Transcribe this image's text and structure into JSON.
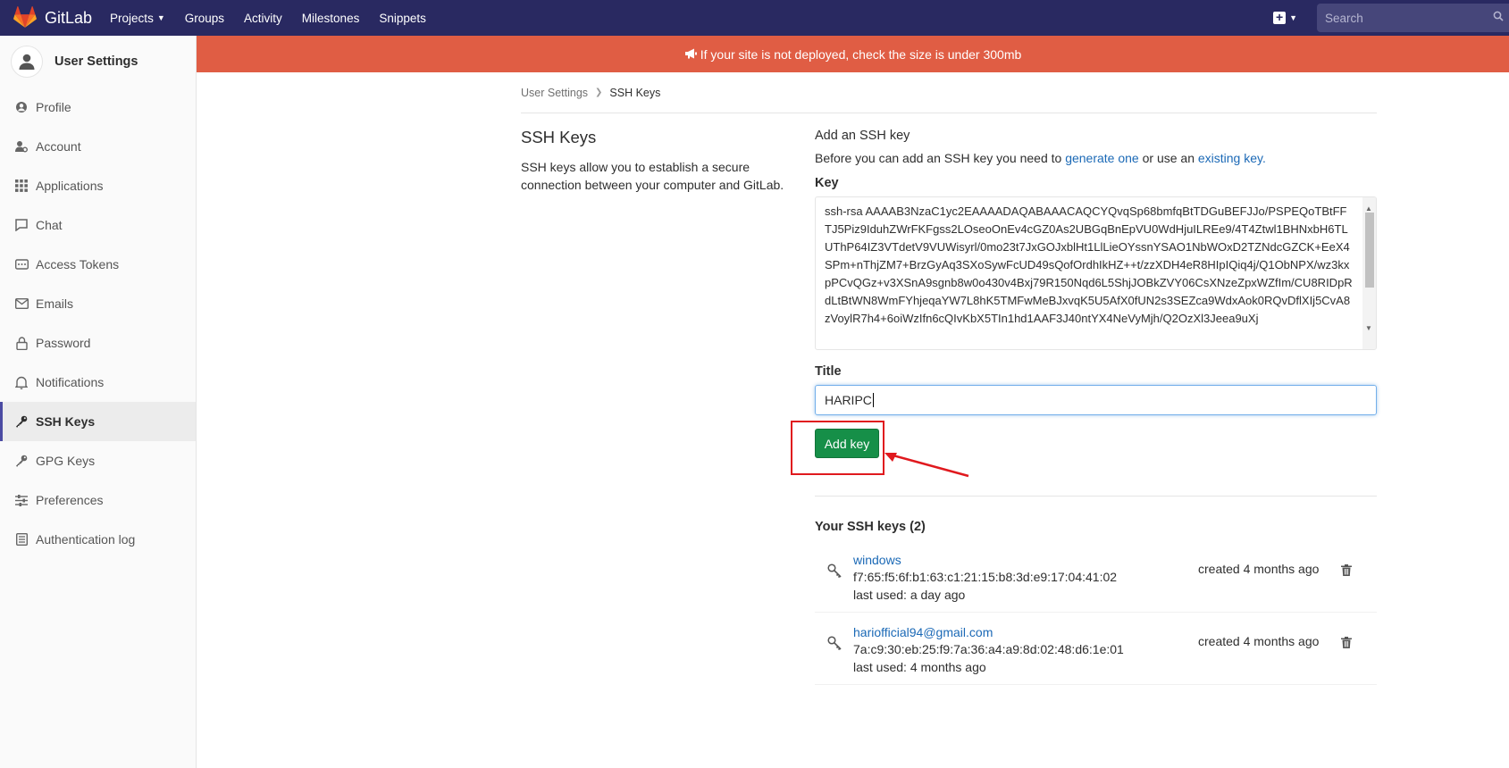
{
  "nav": {
    "brand": "GitLab",
    "links": [
      "Projects",
      "Groups",
      "Activity",
      "Milestones",
      "Snippets"
    ],
    "search_placeholder": "Search"
  },
  "sidebar": {
    "title": "User Settings",
    "items": [
      {
        "label": "Profile",
        "icon": "profile-icon"
      },
      {
        "label": "Account",
        "icon": "account-icon"
      },
      {
        "label": "Applications",
        "icon": "applications-icon"
      },
      {
        "label": "Chat",
        "icon": "chat-icon"
      },
      {
        "label": "Access Tokens",
        "icon": "access-tokens-icon"
      },
      {
        "label": "Emails",
        "icon": "emails-icon"
      },
      {
        "label": "Password",
        "icon": "password-icon"
      },
      {
        "label": "Notifications",
        "icon": "notifications-icon"
      },
      {
        "label": "SSH Keys",
        "icon": "ssh-keys-icon",
        "active": true
      },
      {
        "label": "GPG Keys",
        "icon": "gpg-keys-icon"
      },
      {
        "label": "Preferences",
        "icon": "preferences-icon"
      },
      {
        "label": "Authentication log",
        "icon": "authentication-log-icon"
      }
    ]
  },
  "banner": {
    "text": "If your site is not deployed, check the size is under 300mb"
  },
  "breadcrumb": {
    "parent": "User Settings",
    "current": "SSH Keys"
  },
  "intro": {
    "title": "SSH Keys",
    "description": "SSH keys allow you to establish a secure connection between your computer and GitLab."
  },
  "form": {
    "heading": "Add an SSH key",
    "help_prefix": "Before you can add an SSH key you need to",
    "help_link1": "generate one",
    "help_middle": "or use an",
    "help_link2": "existing key.",
    "key_label": "Key",
    "key_value": "ssh-rsa AAAAB3NzaC1yc2EAAAADAQABAAACAQCYQvqSp68bmfqBtTDGuBEFJJo/PSPEQoTBtFFTJ5Piz9IduhZWrFKFgss2LOseoOnEv4cGZ0As2UBGqBnEpVU0WdHjuILREe9/4T4Ztwl1BHNxbH6TLUThP64IZ3VTdetV9VUWisyrl/0mo23t7JxGOJxblHt1LlLieOYssnYSAO1NbWOxD2TZNdcGZCK+EeX4SPm+nThjZM7+BrzGyAq3SXoSywFcUD49sQofOrdhIkHZ++t/zzXDH4eR8HIpIQiq4j/Q1ObNPX/wz3kxpPCvQGz+v3XSnA9sgnb8w0o430v4Bxj79R150Nqd6L5ShjJOBkZVY06CsXNzeZpxWZfIm/CU8RIDpRdLtBtWN8WmFYhjeqaYW7L8hK5TMFwMeBJxvqK5U5AfX0fUN2s3SEZca9WdxAok0RQvDflXIj5CvA8zVoylR7h4+6oiWzIfn6cQIvKbX5TIn1hd1AAF3J40ntYX4NeVyMjh/Q2OzXl3Jeea9uXj",
    "title_label": "Title",
    "title_value": "HARIPC",
    "add_button": "Add key"
  },
  "keys": {
    "heading": "Your SSH keys (2)",
    "items": [
      {
        "name": "windows",
        "fingerprint": "f7:65:f5:6f:b1:63:c1:21:15:b8:3d:e9:17:04:41:02",
        "last_used": "last used: a day ago",
        "created": "created 4 months ago"
      },
      {
        "name": "hariofficial94@gmail.com",
        "fingerprint": "7a:c9:30:eb:25:f9:7a:36:a4:a9:8d:02:48:d6:1e:01",
        "last_used": "last used: 4 months ago",
        "created": "created 4 months ago"
      }
    ]
  },
  "colors": {
    "navbar": "#292961",
    "banner": "#e05d44",
    "button": "#168f48",
    "link": "#1b69b6",
    "highlight": "#e0191e"
  }
}
